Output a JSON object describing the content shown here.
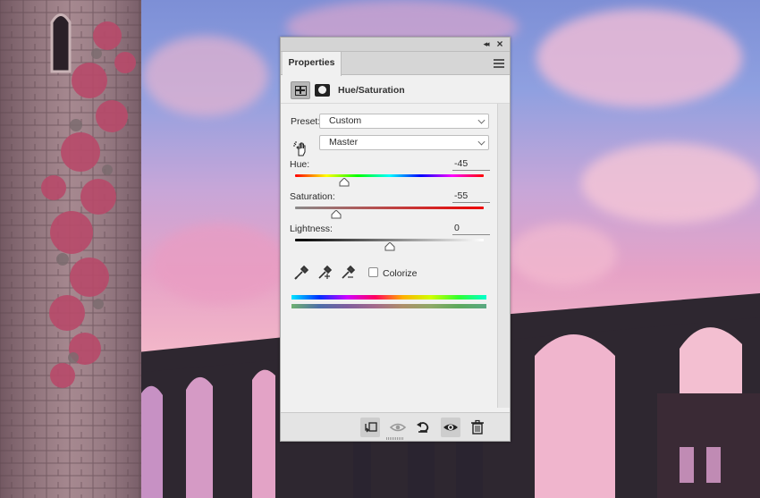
{
  "panel": {
    "tab_label": "Properties",
    "header_title": "Hue/Saturation",
    "preset_label": "Preset:",
    "preset_value": "Custom",
    "channel_value": "Master",
    "hue_label": "Hue:",
    "hue_value": "-45",
    "hue_slider_fraction": 0.26,
    "saturation_label": "Saturation:",
    "saturation_value": "-55",
    "saturation_slider_fraction": 0.22,
    "lightness_label": "Lightness:",
    "lightness_value": "0",
    "lightness_slider_fraction": 0.5,
    "colorize_label": "Colorize",
    "colorize_checked": false
  },
  "icons": {
    "collapse": "double-chevron-icon",
    "close": "close-icon",
    "menu": "panel-menu-icon",
    "adjustment": "hue-saturation-icon",
    "mask": "layer-mask-icon",
    "targeted_adjust": "hand-scrub-icon",
    "eyedropper": "eyedropper-icon",
    "eyedropper_add": "eyedropper-plus-icon",
    "eyedropper_subtract": "eyedropper-minus-icon",
    "clip": "clip-to-layer-icon",
    "view_previous": "view-previous-state-icon",
    "reset": "reset-icon",
    "visibility": "eye-icon",
    "delete": "trash-icon"
  },
  "colors": {
    "panel_bg": "#f0f0f0",
    "tab_bar": "#d6d6d6",
    "sky_top": "#7d8fd6",
    "sky_pink": "#f2b6c9"
  }
}
